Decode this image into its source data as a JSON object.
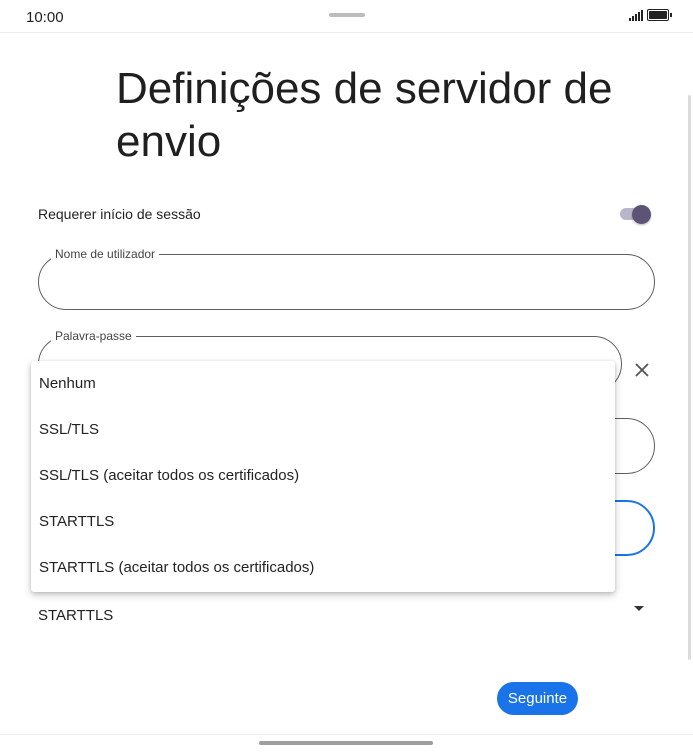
{
  "status_bar": {
    "time": "10:00",
    "icons": [
      "signal-icon",
      "battery-icon"
    ]
  },
  "page": {
    "title": "Definições de servidor de envio"
  },
  "login_toggle": {
    "label": "Requerer início de sessão",
    "on": true
  },
  "username_field": {
    "label": "Nome de utilizador",
    "value": ""
  },
  "password_field": {
    "label": "Palavra-passe",
    "value": ""
  },
  "security": {
    "selected": "STARTTLS",
    "options": [
      "Nenhum",
      "SSL/TLS",
      "SSL/TLS (aceitar todos os certificados)",
      "STARTTLS",
      "STARTTLS (aceitar todos os certificados)"
    ]
  },
  "actions": {
    "next_label": "Seguinte"
  },
  "colors": {
    "accent": "#1a73e8",
    "toggle_thumb": "#5c5475",
    "toggle_track": "#b9b6c9"
  }
}
